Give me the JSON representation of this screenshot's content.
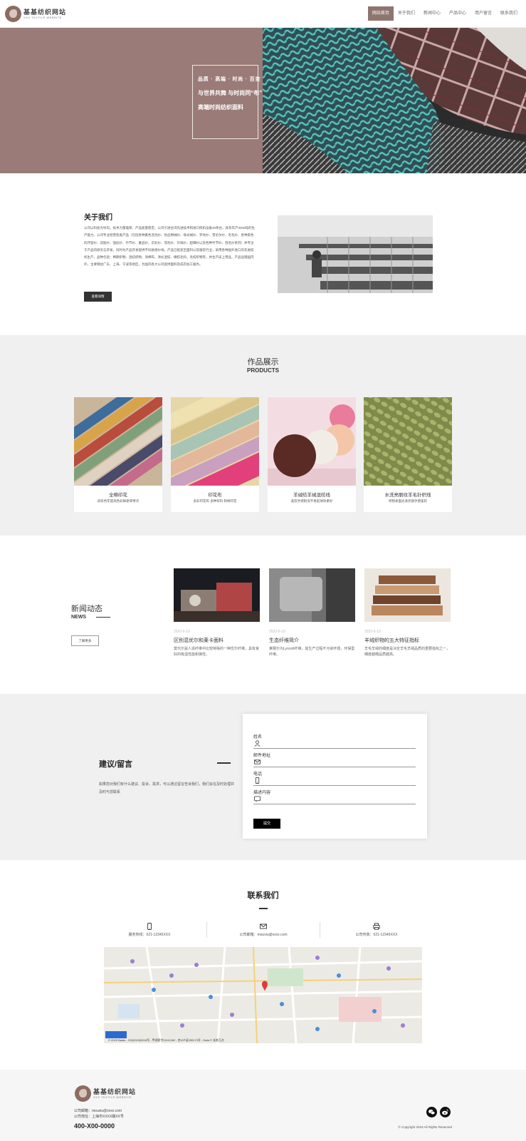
{
  "header": {
    "logo_title": "基基纺织网站",
    "logo_sub": "XXX TEXTILE WEBSITE",
    "nav": [
      "网站首页",
      "关于我们",
      "新闻中心",
      "产品中心",
      "用户留言",
      "联系我们"
    ]
  },
  "hero": {
    "line1": "品质 · 高端 · 时尚 · 百变",
    "line2": "与世界共舞 与时尚同“布”",
    "line3": "高端时尚纺织面料"
  },
  "about": {
    "title": "关于我们",
    "text": "公司以科技为导向，技术力量雄厚，产品质量稳定。公司引进台湾先进技术和进口织机设备30余台，具有年产3000吨的生产能力。公司专业经营各类产品（包括各种素色泡泡纱、仿丝棉绒纱、珠光绒纱、罗纹纱、雪尼尔纱、毛毛纱、各种染色的环锭纱、双股纱、强捻纱、竹节纱、蒙品纱、云彩纱、羽毛纱、珍珠纱、超细纱以及各种竹节纱、羽毛纱系列）并专注于产品的研究与开发，同时为产品开发提供不同质感纱线，产品已拓宽至面料以及服装行业，采用各种国外进口的先进纺机生产，品种包括：棉麻织物、混纺织物、涤棉布、涤纶混纺、精纺毛料、毛纺织物等，并生产床上用品，产品远销国内外，主要销往广东、上海、宁波等地区，为国内各大公司提供面料及成衣加工服务。",
    "button": "查看详情"
  },
  "products": {
    "title": "作品展示",
    "subtitle": "PRODUCTS",
    "items": [
      {
        "name": "全棉印花",
        "desc": "具有色牢度高色彩鲜艳等特点"
      },
      {
        "name": "印花布",
        "desc": "多彩印花布 多种布料 刺绣印花"
      },
      {
        "name": "羊绒纺羊绒混纺线",
        "desc": "柔软手感耐洗不易起球效果好"
      },
      {
        "name": "水洗亮丽纹羊毛针织线",
        "desc": "织物表面光泽亮丽手感柔软"
      }
    ]
  },
  "news": {
    "title": "新闻动态",
    "subtitle": "NEWS",
    "more": "了解更多",
    "items": [
      {
        "date": "2020-6-19",
        "title": "区别混优尔和莱卡面料",
        "summary": "莫代尔是人造纤维中比较特殊的一种优尔纤维，具有良好的吸湿性能和弹性。"
      },
      {
        "date": "2020-6-19",
        "title": "生态纤维简介",
        "summary": "莱赛尔为Lyocell纤维，其生产过程不污染环境，环保型纤维。"
      },
      {
        "date": "2020-6-19",
        "title": "羊绒织物的五大特征指标",
        "summary": "羊毛羊绒的细度是决定羊毛羊绒品质的重要指标之一，细度越细品质越高。"
      }
    ]
  },
  "feedback": {
    "title": "建议/留言",
    "desc": "如果您对我们有什么建议、投诉、需求，可以通过留言告诉我们，我们会在及时处理并及时与您联系",
    "fields": [
      "姓名",
      "邮件地址",
      "电话",
      "描述内容"
    ],
    "submit": "提交"
  },
  "contact": {
    "title": "联系我们",
    "items": [
      {
        "label": "服务热线：021-12345XXX"
      },
      {
        "label": "公司邮箱：mouxiu@xxxx.com"
      },
      {
        "label": "公司传真：021-12345XXX"
      }
    ],
    "map_copy": "© 2020 Baidu - GS(2019)5218号 - 甲测资字11111342 - 京ICP证030173号 - Data © 长地万方"
  },
  "footer": {
    "logo_title": "基基纺织网站",
    "logo_sub": "XXX TEXTILE WEBSITE",
    "email": "公司邮箱：mouxiu@xxxx.com",
    "address": "公司地址：上海市XXXX路XX号",
    "phone": "400-X00-0000",
    "copyright": "© Copyright 2019 All Rights Reserved"
  },
  "colors": {
    "brand": "#8f7570",
    "hero_bg": "#9a7b77",
    "section_bg": "#f0f0f0",
    "dark": "#333333"
  },
  "icons": [
    "user-icon",
    "mail-icon",
    "phone-icon",
    "message-icon",
    "wechat-icon",
    "weibo-icon",
    "fax-icon"
  ]
}
